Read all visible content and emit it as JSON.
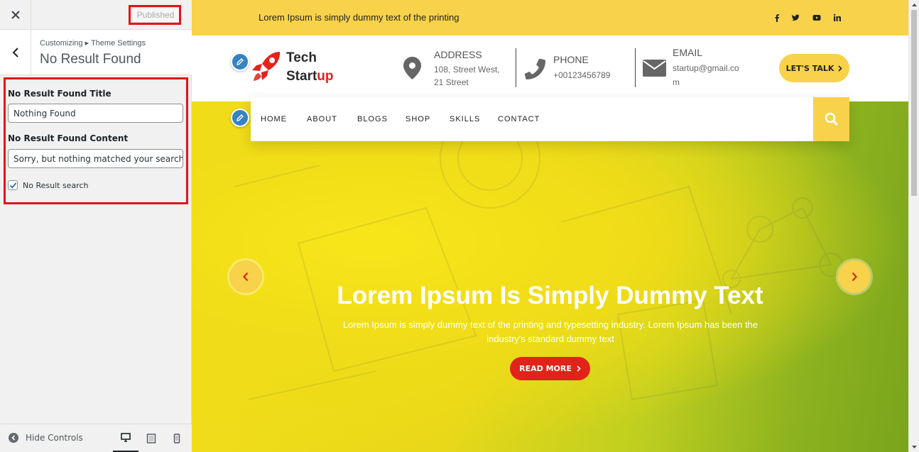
{
  "sidebar": {
    "close_icon": "close-icon",
    "published_label": "Published",
    "breadcrumb": "Customizing ▸ Theme Settings",
    "section_title": "No Result Found",
    "fields": {
      "title_label": "No Result Found Title",
      "title_value": "Nothing Found",
      "content_label": "No Result Found Content",
      "content_value": "Sorry, but nothing matched your search t",
      "checkbox_label": "No Result search",
      "checkbox_checked": true
    },
    "footer": {
      "hide_controls_label": "Hide Controls",
      "devices": [
        "desktop",
        "tablet",
        "mobile"
      ],
      "active_device": "desktop"
    }
  },
  "preview": {
    "topbar": {
      "text": "Lorem Ipsum is simply dummy text of the printing",
      "social": [
        "facebook",
        "twitter",
        "youtube",
        "linkedin"
      ]
    },
    "logo": {
      "line1": "Tech",
      "line2_a": "Start",
      "line2_b": "up"
    },
    "address": {
      "title": "ADDRESS",
      "line1": "108, Street West,",
      "line2": "21 Street"
    },
    "phone": {
      "title": "PHONE",
      "value": "+00123456789"
    },
    "email": {
      "title": "EMAIL",
      "line1": "startup@gmail.co",
      "line2": "m"
    },
    "talk_button": "LET'S TALK",
    "nav": [
      "HOME",
      "ABOUT",
      "BLOGS",
      "SHOP",
      "SKILLS",
      "CONTACT"
    ],
    "hero": {
      "title": "Lorem Ipsum Is Simply Dummy Text",
      "subtitle": "Lorem Ipsum is simply dummy text of the printing and typesetting industry. Lorem Ipsum has been the industry's standard dummy text",
      "button": "READ MORE"
    }
  },
  "colors": {
    "accent_yellow": "#f7d24a",
    "button_red": "#e1231a",
    "highlight_red": "#e1141b",
    "edit_blue": "#3582c4"
  }
}
